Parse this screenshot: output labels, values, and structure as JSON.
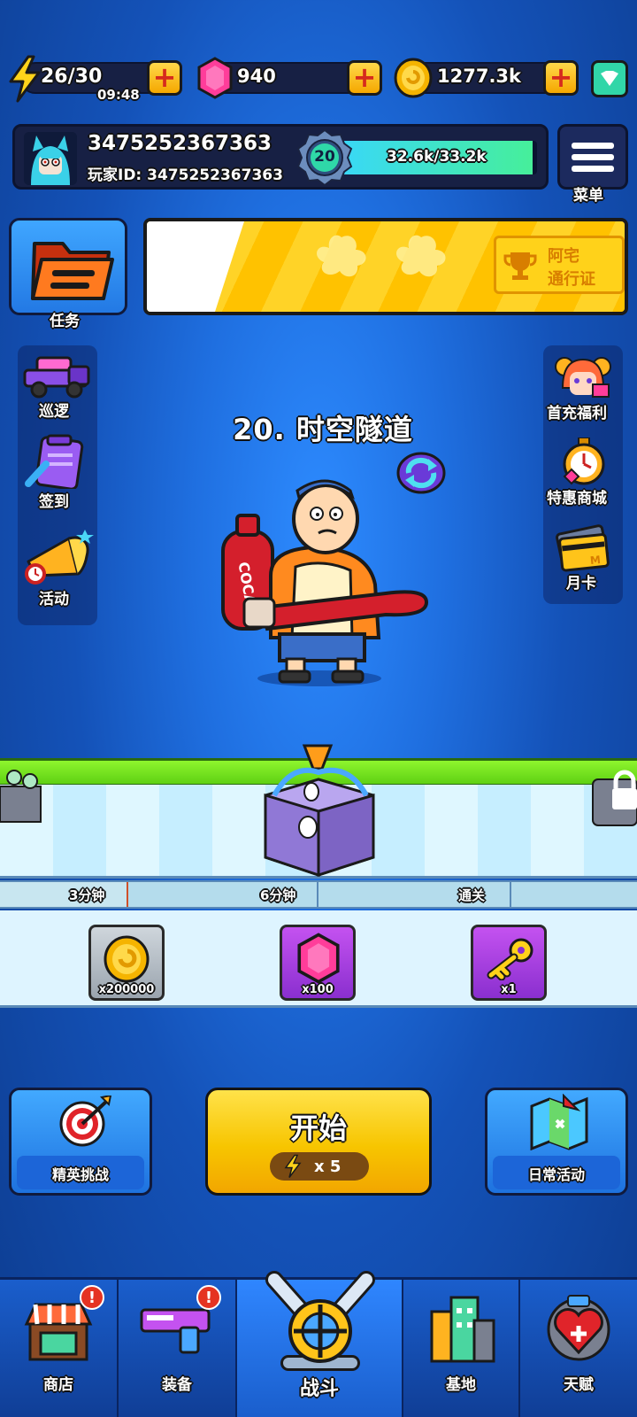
{
  "resources": {
    "energy": "26/30",
    "energy_timer": "09:48",
    "gems": "940",
    "coins": "1277.3k"
  },
  "profile": {
    "name": "3475252367363",
    "player_id_label": "玩家ID: 3475252367363",
    "level": "20",
    "xp_text": "32.6k/33.2k",
    "xp_progress": 0.98
  },
  "menu_label": "菜单",
  "task_label": "任务",
  "battle_pass_label_line1": "阿宅",
  "battle_pass_label_line2": "通行证",
  "left_items": [
    "巡逻",
    "签到",
    "活动"
  ],
  "right_items": [
    "首充福利",
    "特惠商城",
    "月卡"
  ],
  "stage_title": "20. 时空隧道",
  "progress": {
    "milestones": [
      "3分钟",
      "6分钟",
      "通关"
    ]
  },
  "rewards": [
    {
      "icon": "coin-icon",
      "count": "x200000"
    },
    {
      "icon": "gem-icon",
      "count": "x100"
    },
    {
      "icon": "key-icon",
      "count": "x1"
    }
  ],
  "elite_label": "精英挑战",
  "start_label": "开始",
  "start_cost": "x 5",
  "daily_label": "日常活动",
  "tabs": [
    {
      "label": "商店",
      "badge": "!"
    },
    {
      "label": "装备",
      "badge": "!"
    },
    {
      "label": "战斗",
      "badge": ""
    },
    {
      "label": "基地",
      "badge": ""
    },
    {
      "label": "天赋",
      "badge": ""
    }
  ],
  "colors": {
    "accent_yellow": "#f7c500",
    "background_blue": "#1f6fe0",
    "gem_pink": "#ff3d9a",
    "xp_green": "#46ef9a"
  }
}
